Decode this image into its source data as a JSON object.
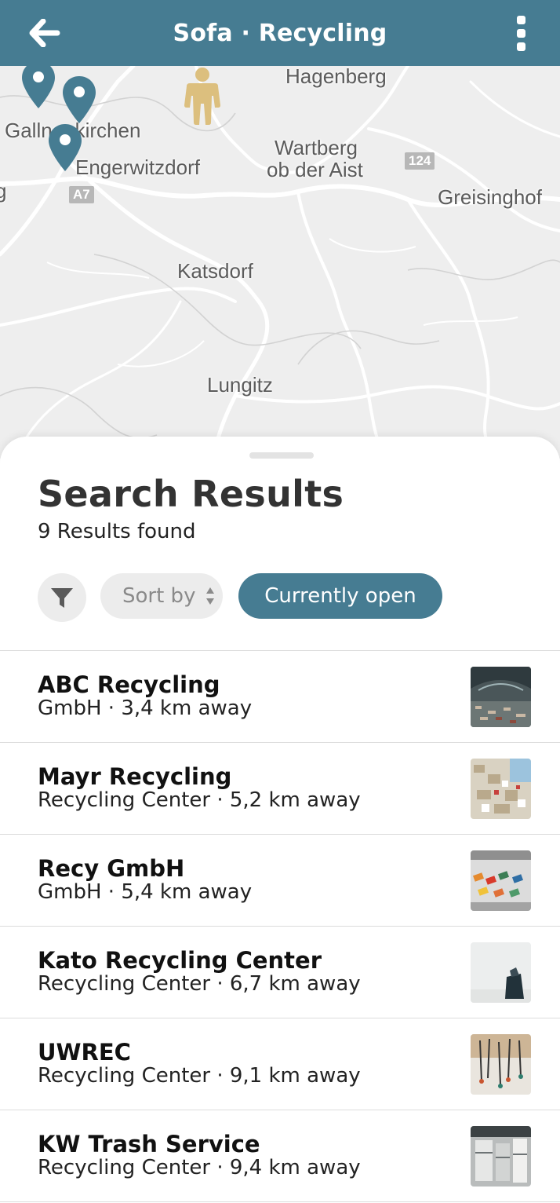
{
  "app_bar": {
    "title": "Sofa · Recycling",
    "back_icon": "arrow-left-icon",
    "menu_icon": "more-vertical-icon"
  },
  "map": {
    "places": {
      "hagenberg": "Hagenberg",
      "gallneukirchen": "Gallneukirchen",
      "engerwitzdorf": "Engerwitzdorf",
      "wartberg_line1": "Wartberg",
      "wartberg_line2": "ob der Aist",
      "greisinghof": "Greisinghof",
      "katsdorf": "Katsdorf",
      "lungitz": "Lungitz"
    },
    "shields": {
      "road_124": "124",
      "road_a7": "A7"
    },
    "pin_color": "#467c92",
    "person_color": "#dcbf7e"
  },
  "sheet": {
    "title": "Search Results",
    "result_count": "9 Results found",
    "filter_icon": "filter-icon",
    "sort_label": "Sort by",
    "open_filter_label": "Currently open"
  },
  "results": [
    {
      "name": "ABC Recycling",
      "subtitle": "GmbH · 3,4 km away"
    },
    {
      "name": "Mayr Recycling",
      "subtitle": "Recycling Center · 5,2 km away"
    },
    {
      "name": "Recy GmbH",
      "subtitle": "GmbH · 5,4 km away"
    },
    {
      "name": "Kato Recycling Center",
      "subtitle": "Recycling Center · 6,7 km away"
    },
    {
      "name": "UWREC",
      "subtitle": "Recycling Center · 9,1 km away"
    },
    {
      "name": "KW Trash Service",
      "subtitle": "Recycling Center · 9,4 km away"
    }
  ],
  "colors": {
    "accent": "#467c92",
    "chip_bg": "#ececec"
  }
}
